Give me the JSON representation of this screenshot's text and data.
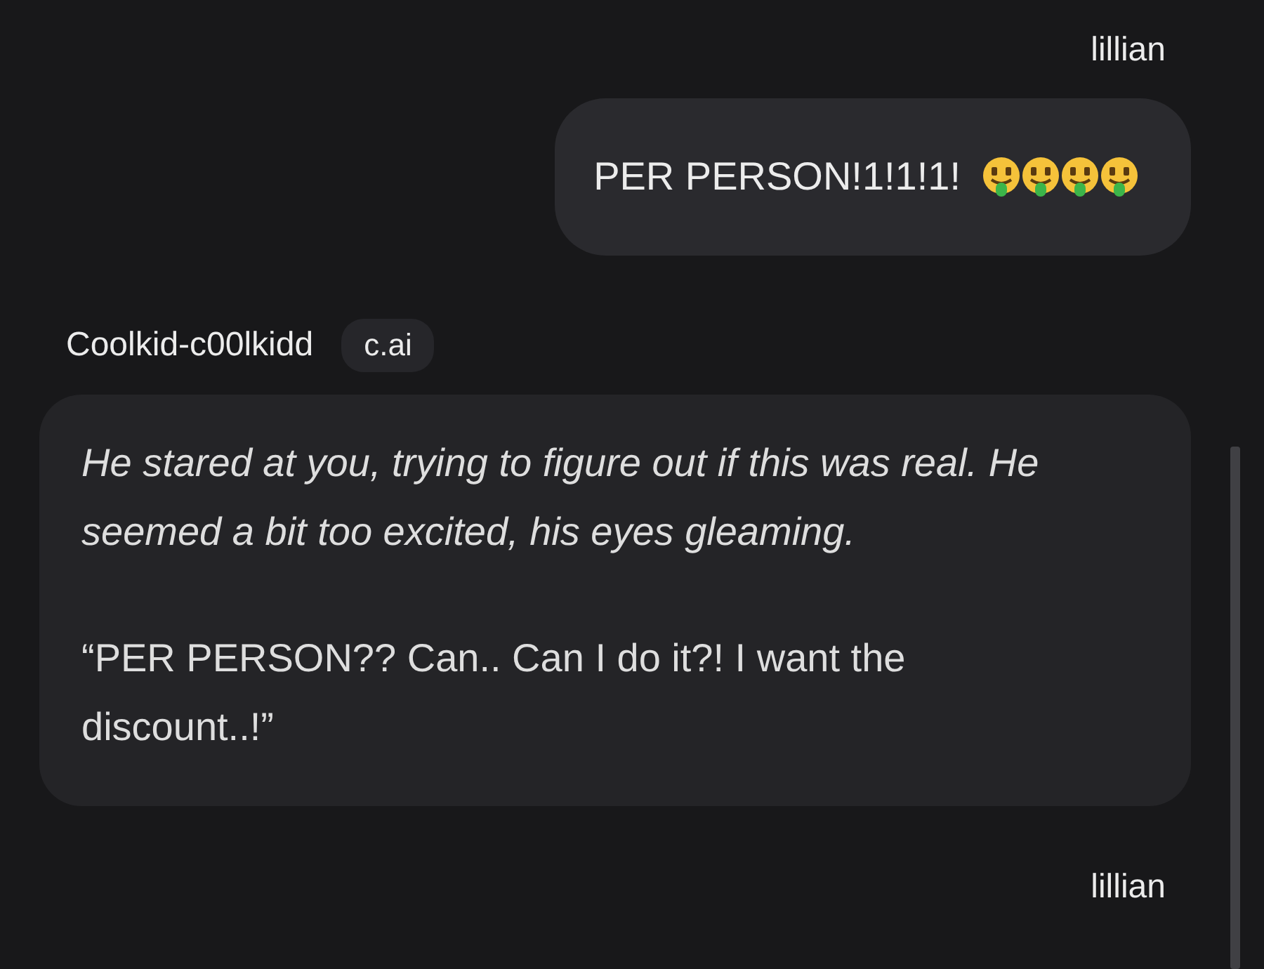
{
  "messages": [
    {
      "kind": "user",
      "author": "lillian",
      "text": "PER PERSON!1!1!1!"
    },
    {
      "kind": "bot",
      "author": "Coolkid-c00lkidd",
      "tag": "c.ai",
      "paragraphs": [
        {
          "kind": "narration",
          "text": "He stared at you, trying to figure out if this was real. He seemed a bit too excited, his eyes gleaming."
        },
        {
          "kind": "dialogue",
          "text": "“PER PERSON?? Can.. Can I do it?! I want the discount..!”"
        }
      ]
    },
    {
      "kind": "user",
      "author": "lillian"
    }
  ]
}
